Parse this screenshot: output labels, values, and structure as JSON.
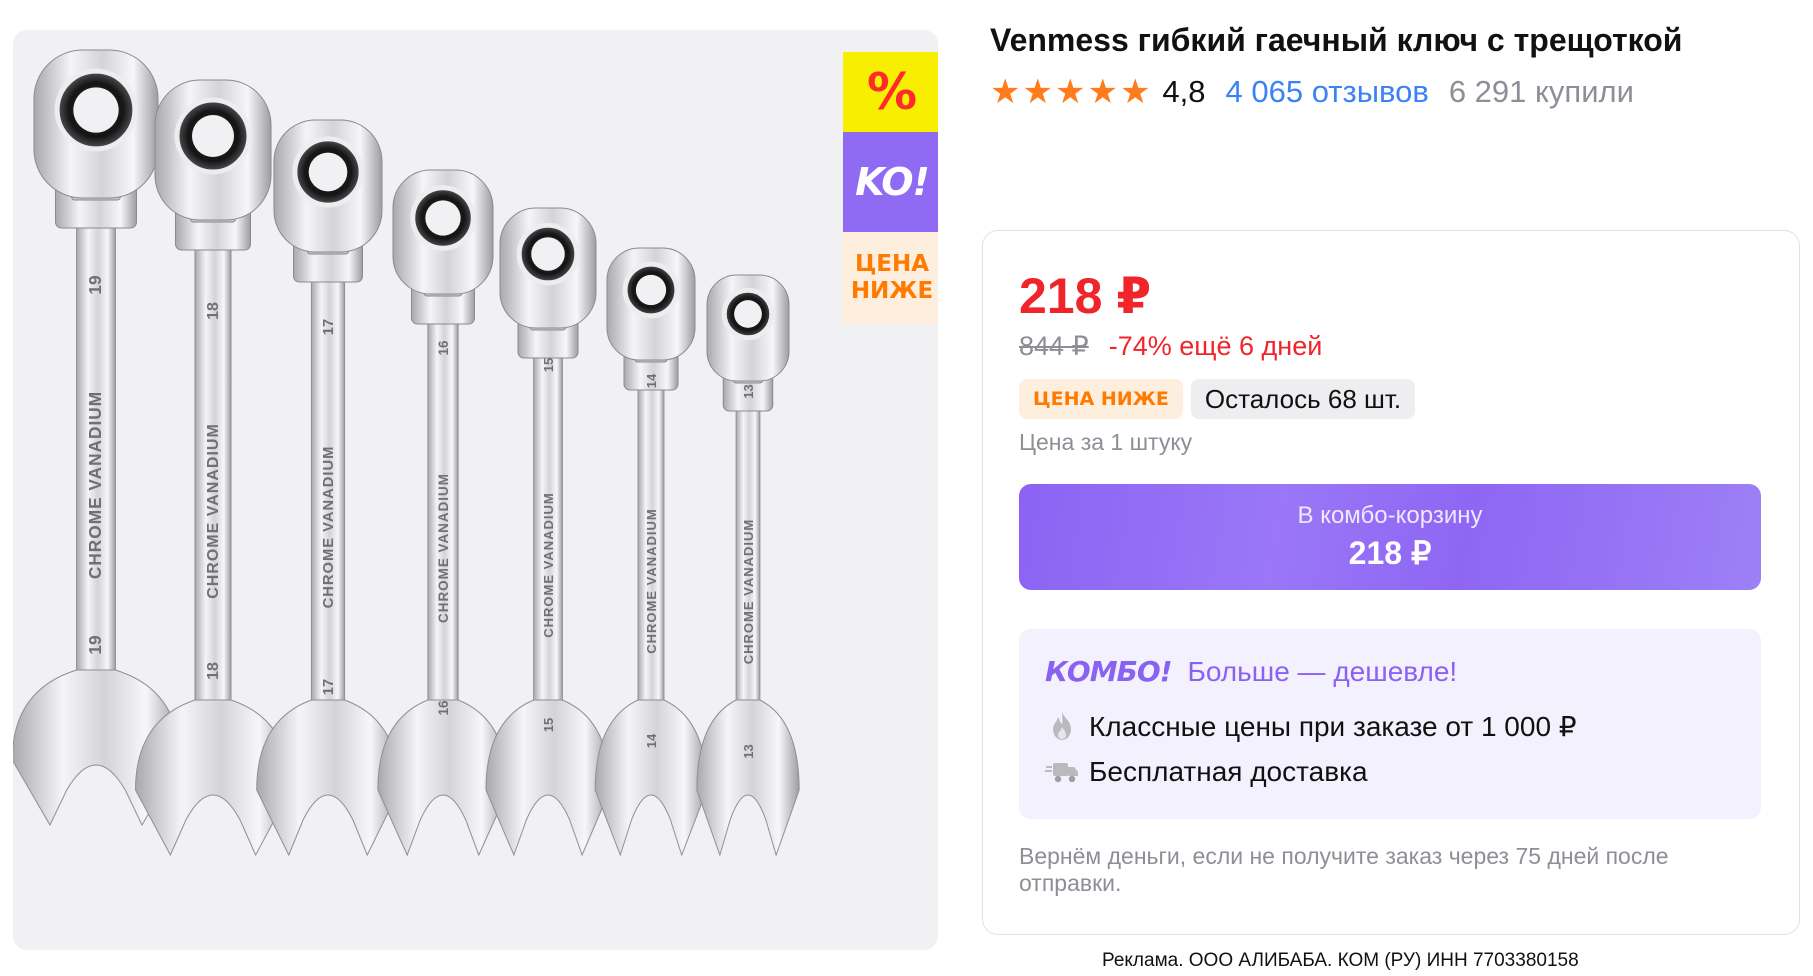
{
  "product": {
    "title": "Venmess гибкий гаечный ключ с трещоткой",
    "rating": "4,8",
    "stars_filled": 5,
    "reviews": "4 065 отзывов",
    "bought": "6 291 купили"
  },
  "gallery": {
    "promo_percent": "%",
    "promo_ko": "KO!",
    "promo_price_lower_line1": "ЦЕНА",
    "promo_price_lower_line2": "НИЖЕ",
    "wrenches": [
      {
        "size": "19",
        "brand": "CHROME VANADIUM"
      },
      {
        "size": "18",
        "brand": "CHROME VANADIUM"
      },
      {
        "size": "17",
        "brand": "CHROME VANADIUM"
      },
      {
        "size": "16",
        "brand": "CHROME VANADIUM"
      },
      {
        "size": "15",
        "brand": "CHROME VANADIUM"
      },
      {
        "size": "14",
        "brand": "CHROME VANADIUM"
      },
      {
        "size": "13",
        "brand": "CHROME VANADIUM"
      }
    ]
  },
  "offer": {
    "price": "218 ₽",
    "old_price": "844 ₽",
    "discount": "-74% ещё 6 дней",
    "badge_price_lower": "ЦЕНА НИЖЕ",
    "stock": "Осталось 68 шт.",
    "unit_note": "Цена за 1 штуку",
    "cart_label": "В комбо-корзину",
    "cart_price": "218 ₽",
    "refund_note": "Вернём деньги, если не получите заказ через 75 дней после отправки."
  },
  "combo": {
    "logo": "КОМБО!",
    "tagline": "Больше — дешевле!",
    "features": [
      {
        "icon": "flame-icon",
        "text": "Классные цены при заказе от 1 000 ₽"
      },
      {
        "icon": "delivery-truck-icon",
        "text": "Бесплатная доставка"
      }
    ]
  },
  "footer": {
    "ad_note": "Реклама. ООО АЛИБАБА. КОМ (РУ) ИНН 7703380158"
  },
  "colors": {
    "accent_purple": "#8e66f3",
    "price_red": "#f0252b",
    "star_orange": "#ff7b1c",
    "link_blue": "#3b82f6",
    "promo_yellow": "#f8ee00"
  }
}
